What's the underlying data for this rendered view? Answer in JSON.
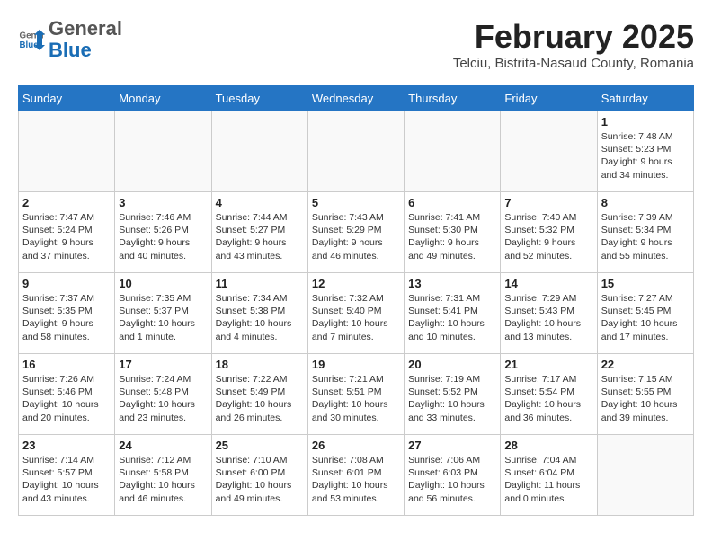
{
  "header": {
    "logo_general": "General",
    "logo_blue": "Blue",
    "month_title": "February 2025",
    "location": "Telciu, Bistrita-Nasaud County, Romania"
  },
  "weekdays": [
    "Sunday",
    "Monday",
    "Tuesday",
    "Wednesday",
    "Thursday",
    "Friday",
    "Saturday"
  ],
  "weeks": [
    [
      {
        "day": "",
        "info": ""
      },
      {
        "day": "",
        "info": ""
      },
      {
        "day": "",
        "info": ""
      },
      {
        "day": "",
        "info": ""
      },
      {
        "day": "",
        "info": ""
      },
      {
        "day": "",
        "info": ""
      },
      {
        "day": "1",
        "info": "Sunrise: 7:48 AM\nSunset: 5:23 PM\nDaylight: 9 hours and 34 minutes."
      }
    ],
    [
      {
        "day": "2",
        "info": "Sunrise: 7:47 AM\nSunset: 5:24 PM\nDaylight: 9 hours and 37 minutes."
      },
      {
        "day": "3",
        "info": "Sunrise: 7:46 AM\nSunset: 5:26 PM\nDaylight: 9 hours and 40 minutes."
      },
      {
        "day": "4",
        "info": "Sunrise: 7:44 AM\nSunset: 5:27 PM\nDaylight: 9 hours and 43 minutes."
      },
      {
        "day": "5",
        "info": "Sunrise: 7:43 AM\nSunset: 5:29 PM\nDaylight: 9 hours and 46 minutes."
      },
      {
        "day": "6",
        "info": "Sunrise: 7:41 AM\nSunset: 5:30 PM\nDaylight: 9 hours and 49 minutes."
      },
      {
        "day": "7",
        "info": "Sunrise: 7:40 AM\nSunset: 5:32 PM\nDaylight: 9 hours and 52 minutes."
      },
      {
        "day": "8",
        "info": "Sunrise: 7:39 AM\nSunset: 5:34 PM\nDaylight: 9 hours and 55 minutes."
      }
    ],
    [
      {
        "day": "9",
        "info": "Sunrise: 7:37 AM\nSunset: 5:35 PM\nDaylight: 9 hours and 58 minutes."
      },
      {
        "day": "10",
        "info": "Sunrise: 7:35 AM\nSunset: 5:37 PM\nDaylight: 10 hours and 1 minute."
      },
      {
        "day": "11",
        "info": "Sunrise: 7:34 AM\nSunset: 5:38 PM\nDaylight: 10 hours and 4 minutes."
      },
      {
        "day": "12",
        "info": "Sunrise: 7:32 AM\nSunset: 5:40 PM\nDaylight: 10 hours and 7 minutes."
      },
      {
        "day": "13",
        "info": "Sunrise: 7:31 AM\nSunset: 5:41 PM\nDaylight: 10 hours and 10 minutes."
      },
      {
        "day": "14",
        "info": "Sunrise: 7:29 AM\nSunset: 5:43 PM\nDaylight: 10 hours and 13 minutes."
      },
      {
        "day": "15",
        "info": "Sunrise: 7:27 AM\nSunset: 5:45 PM\nDaylight: 10 hours and 17 minutes."
      }
    ],
    [
      {
        "day": "16",
        "info": "Sunrise: 7:26 AM\nSunset: 5:46 PM\nDaylight: 10 hours and 20 minutes."
      },
      {
        "day": "17",
        "info": "Sunrise: 7:24 AM\nSunset: 5:48 PM\nDaylight: 10 hours and 23 minutes."
      },
      {
        "day": "18",
        "info": "Sunrise: 7:22 AM\nSunset: 5:49 PM\nDaylight: 10 hours and 26 minutes."
      },
      {
        "day": "19",
        "info": "Sunrise: 7:21 AM\nSunset: 5:51 PM\nDaylight: 10 hours and 30 minutes."
      },
      {
        "day": "20",
        "info": "Sunrise: 7:19 AM\nSunset: 5:52 PM\nDaylight: 10 hours and 33 minutes."
      },
      {
        "day": "21",
        "info": "Sunrise: 7:17 AM\nSunset: 5:54 PM\nDaylight: 10 hours and 36 minutes."
      },
      {
        "day": "22",
        "info": "Sunrise: 7:15 AM\nSunset: 5:55 PM\nDaylight: 10 hours and 39 minutes."
      }
    ],
    [
      {
        "day": "23",
        "info": "Sunrise: 7:14 AM\nSunset: 5:57 PM\nDaylight: 10 hours and 43 minutes."
      },
      {
        "day": "24",
        "info": "Sunrise: 7:12 AM\nSunset: 5:58 PM\nDaylight: 10 hours and 46 minutes."
      },
      {
        "day": "25",
        "info": "Sunrise: 7:10 AM\nSunset: 6:00 PM\nDaylight: 10 hours and 49 minutes."
      },
      {
        "day": "26",
        "info": "Sunrise: 7:08 AM\nSunset: 6:01 PM\nDaylight: 10 hours and 53 minutes."
      },
      {
        "day": "27",
        "info": "Sunrise: 7:06 AM\nSunset: 6:03 PM\nDaylight: 10 hours and 56 minutes."
      },
      {
        "day": "28",
        "info": "Sunrise: 7:04 AM\nSunset: 6:04 PM\nDaylight: 11 hours and 0 minutes."
      },
      {
        "day": "",
        "info": ""
      }
    ]
  ]
}
